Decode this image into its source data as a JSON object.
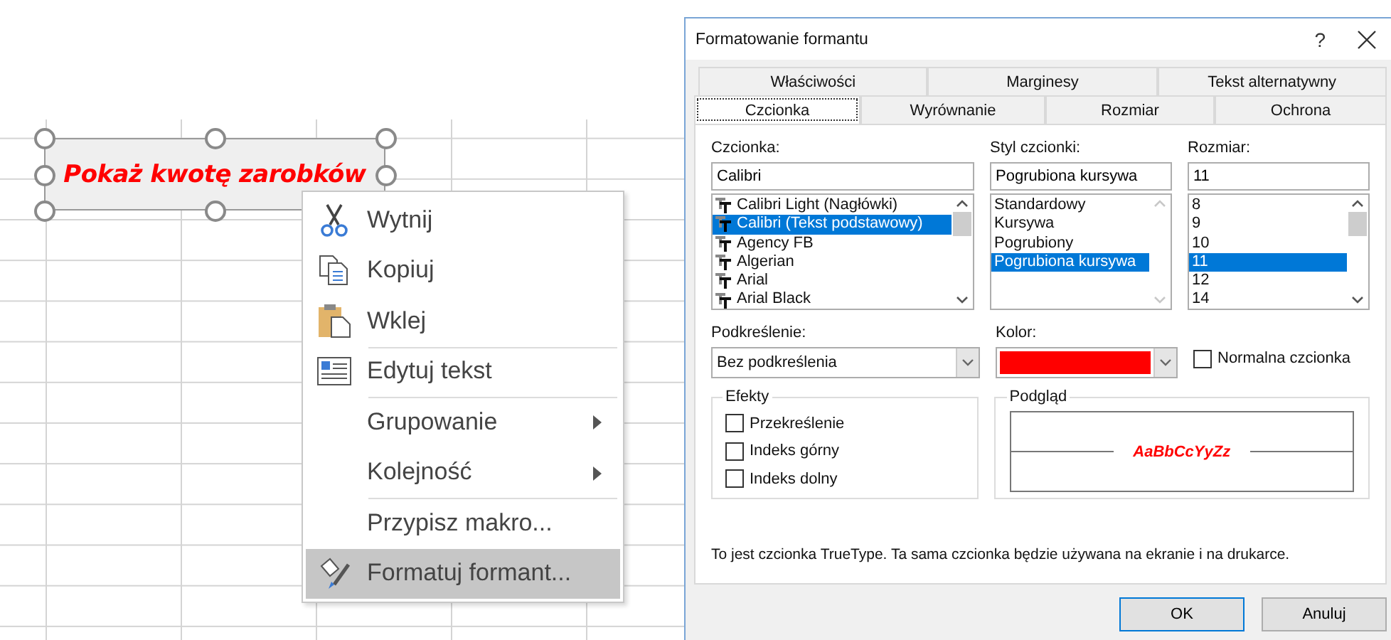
{
  "shape": {
    "text": "Pokaż kwotę zarobków",
    "selected": true
  },
  "context_menu": {
    "items": [
      {
        "label": "Wytnij",
        "kind": "scissors",
        "separator_before": false,
        "submenu": false,
        "highlighted": false
      },
      {
        "label": "Kopiuj",
        "kind": "copy",
        "separator_before": false,
        "submenu": false,
        "highlighted": false
      },
      {
        "label": "Wklej",
        "kind": "paste",
        "separator_before": false,
        "submenu": false,
        "highlighted": false
      },
      {
        "label": "Edytuj tekst",
        "kind": "edit",
        "separator_before": true,
        "submenu": false,
        "highlighted": false
      },
      {
        "label": "Grupowanie",
        "kind": "plain",
        "separator_before": true,
        "submenu": true,
        "highlighted": false
      },
      {
        "label": "Kolejność",
        "kind": "plain",
        "separator_before": false,
        "submenu": true,
        "highlighted": false
      },
      {
        "label": "Przypisz makro...",
        "kind": "plain",
        "separator_before": true,
        "submenu": false,
        "highlighted": false
      },
      {
        "label": "Formatuj formant...",
        "kind": "format",
        "separator_before": false,
        "submenu": false,
        "highlighted": true
      }
    ]
  },
  "dialog": {
    "title": "Formatowanie formantu",
    "help": "?",
    "tab_rows": [
      [
        {
          "label": "Właściwości",
          "selected": false
        },
        {
          "label": "Marginesy",
          "selected": false
        },
        {
          "label": "Tekst alternatywny",
          "selected": false
        }
      ],
      [
        {
          "label": "Czcionka",
          "selected": true
        },
        {
          "label": "Wyrównanie",
          "selected": false
        },
        {
          "label": "Rozmiar",
          "selected": false
        },
        {
          "label": "Ochrona",
          "selected": false
        }
      ]
    ],
    "pickers": [
      {
        "label": "Czcionka:",
        "value": "Calibri",
        "font_icons": true,
        "scrollbar_disabled": false,
        "items": [
          {
            "label": "Calibri Light (Nagłówki)",
            "selected": false
          },
          {
            "label": "Calibri (Tekst podstawowy)",
            "selected": true
          },
          {
            "label": "Agency FB",
            "selected": false
          },
          {
            "label": "Algerian",
            "selected": false
          },
          {
            "label": "Arial",
            "selected": false
          },
          {
            "label": "Arial Black",
            "selected": false
          }
        ]
      },
      {
        "label": "Styl czcionki:",
        "value": "Pogrubiona kursywa",
        "font_icons": false,
        "scrollbar_disabled": true,
        "items": [
          {
            "label": "Standardowy",
            "selected": false
          },
          {
            "label": "Kursywa",
            "selected": false
          },
          {
            "label": "Pogrubiony",
            "selected": false
          },
          {
            "label": "Pogrubiona kursywa",
            "selected": true
          }
        ]
      },
      {
        "label": "Rozmiar:",
        "value": "11",
        "font_icons": false,
        "scrollbar_disabled": false,
        "items": [
          {
            "label": "8",
            "selected": false
          },
          {
            "label": "9",
            "selected": false
          },
          {
            "label": "10",
            "selected": false
          },
          {
            "label": "11",
            "selected": true
          },
          {
            "label": "12",
            "selected": false
          },
          {
            "label": "14",
            "selected": false
          }
        ]
      }
    ],
    "underline": {
      "label": "Podkreślenie:",
      "value": "Bez podkreślenia"
    },
    "color": {
      "label": "Kolor:",
      "color": "#ff0000"
    },
    "normal_font": {
      "label": "Normalna czcionka",
      "checked": false
    },
    "effects": {
      "title": "Efekty",
      "options": [
        {
          "label": "Przekreślenie",
          "checked": false
        },
        {
          "label": "Indeks górny",
          "checked": false
        },
        {
          "label": "Indeks dolny",
          "checked": false
        }
      ]
    },
    "preview": {
      "title": "Podgląd",
      "sample": "AaBbCcYyZz"
    },
    "info": "To jest czcionka TrueType. Ta sama czcionka będzie używana na ekranie i na drukarce.",
    "buttons": [
      {
        "label": "OK",
        "default": true
      },
      {
        "label": "Anuluj",
        "default": false
      }
    ]
  }
}
